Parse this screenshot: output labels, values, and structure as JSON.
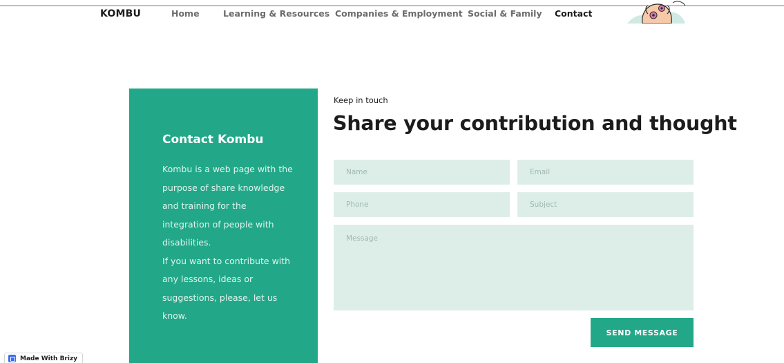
{
  "nav": {
    "brand": "KOMBU",
    "links": [
      {
        "label": "Home"
      },
      {
        "label": "Learning & Resources"
      },
      {
        "label": "Companies & Employment"
      },
      {
        "label": "Social & Family"
      },
      {
        "label": "Contact"
      }
    ],
    "active": "Contact"
  },
  "contact_card": {
    "title": "Contact Kombu",
    "paragraph1": "Kombu is a web page with the purpose of share knowledge and training for the integration of people with disabilities.",
    "paragraph2": "If you want to contribute with any lessons, ideas or suggestions, please, let us know."
  },
  "form": {
    "kicker": "Keep in touch",
    "heading": "Share your contribution and thought",
    "name_placeholder": "Name",
    "email_placeholder": "Email",
    "phone_placeholder": "Phone",
    "subject_placeholder": "Subject",
    "message_placeholder": "Message",
    "submit_label": "SEND MESSAGE"
  },
  "badge": {
    "label": "Made With Brizy"
  },
  "colors": {
    "accent": "#22a888",
    "field_bg": "#ddeee9",
    "text_dark": "#1c1c1c",
    "nav_muted": "#6c6c6c"
  }
}
